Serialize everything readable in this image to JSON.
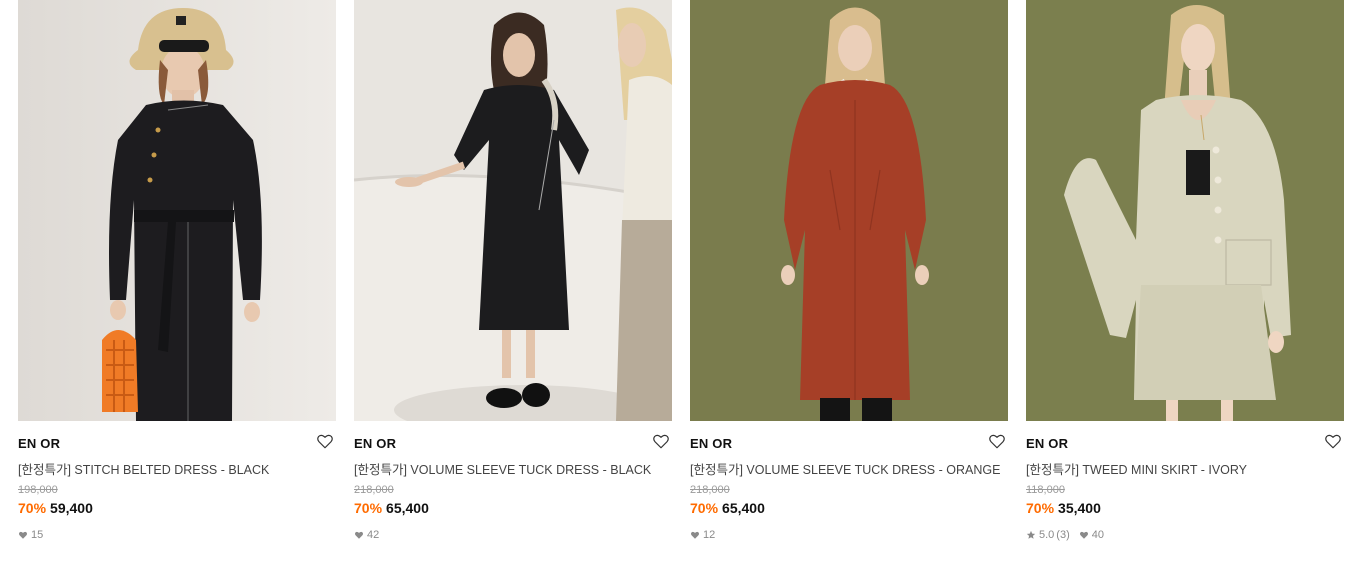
{
  "products": [
    {
      "brand": "EN OR",
      "name": "[한정특가] STITCH BELTED DRESS - BLACK",
      "original_price": "198,000",
      "discount": "70%",
      "price": "59,400",
      "likes": "15",
      "colors": {
        "bg": "#e6e3df",
        "garment": "#1d1c1f"
      }
    },
    {
      "brand": "EN OR",
      "name": "[한정특가] VOLUME SLEEVE TUCK DRESS - BLACK",
      "original_price": "218,000",
      "discount": "70%",
      "price": "65,400",
      "likes": "42",
      "colors": {
        "bg": "#e8e5e0",
        "garment": "#1c1c1e"
      }
    },
    {
      "brand": "EN OR",
      "name": "[한정특가] VOLUME SLEEVE TUCK DRESS - ORANGE",
      "original_price": "218,000",
      "discount": "70%",
      "price": "65,400",
      "likes": "12",
      "colors": {
        "bg": "#7a7c4d",
        "garment": "#a63f27"
      }
    },
    {
      "brand": "EN OR",
      "name": "[한정특가] TWEED MINI SKIRT - IVORY",
      "original_price": "118,000",
      "discount": "70%",
      "price": "35,400",
      "rating": "5.0",
      "review_count": "(3)",
      "likes": "40",
      "colors": {
        "bg": "#7b7f4e",
        "garment": "#d9d6bf"
      }
    }
  ],
  "icons": {
    "wishlist": "heart-outline-icon",
    "likes": "heart-filled-icon",
    "rating": "star-icon"
  },
  "accent_color": "#ff6b00"
}
